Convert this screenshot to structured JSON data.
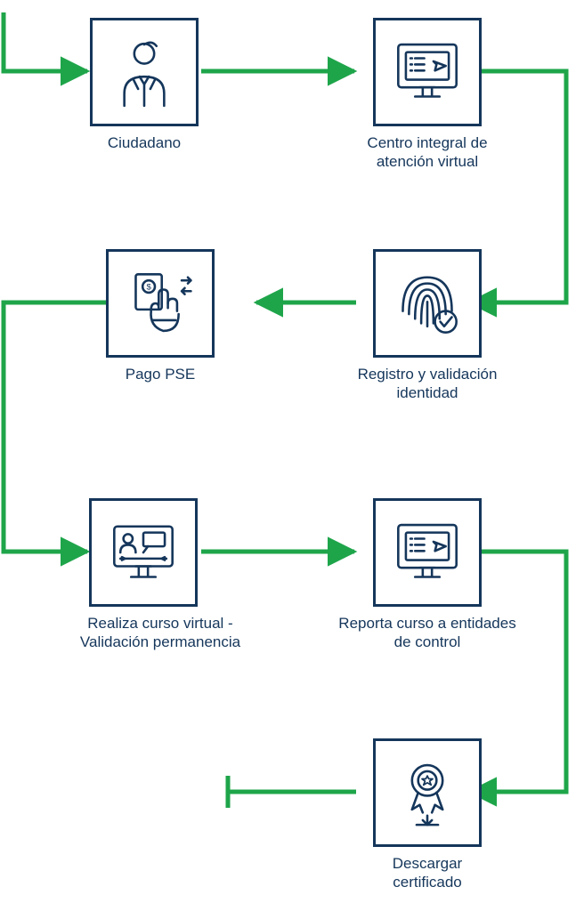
{
  "process": {
    "type": "serpentine-flow",
    "direction": "start-left",
    "arrow_color": "#1ea54a",
    "node_border_color": "#15365b",
    "label_color": "#15365b",
    "steps": [
      {
        "id": "ciudadano",
        "label": "Ciudadano",
        "icon": "person-icon"
      },
      {
        "id": "centro-integral",
        "label": "Centro integral de atención virtual",
        "icon": "virtual-center-icon"
      },
      {
        "id": "registro-validacion",
        "label": "Registro y validación identidad",
        "icon": "fingerprint-icon"
      },
      {
        "id": "pago-pse",
        "label": "Pago PSE",
        "icon": "payment-icon"
      },
      {
        "id": "curso-virtual",
        "label": "Realiza curso virtual - Validación permanencia",
        "icon": "virtual-course-icon"
      },
      {
        "id": "reporta-curso",
        "label": "Reporta curso a entidades de control",
        "icon": "report-icon"
      },
      {
        "id": "descargar-certificado",
        "label": "Descargar certificado",
        "icon": "certificate-icon"
      }
    ]
  }
}
